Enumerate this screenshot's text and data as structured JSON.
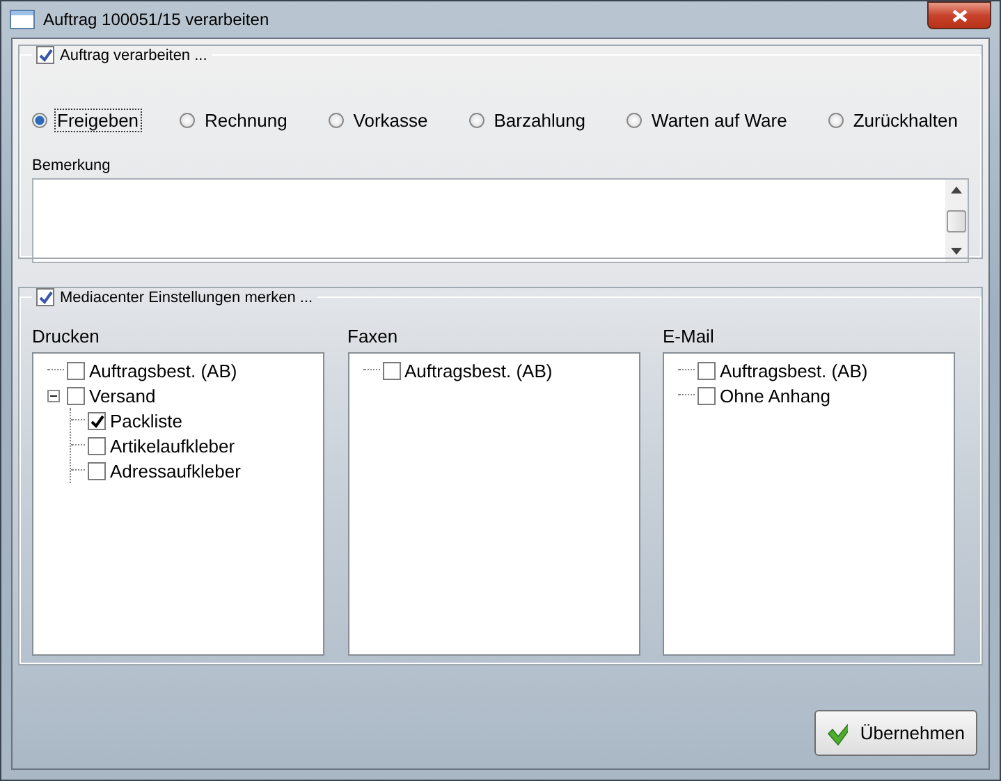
{
  "window": {
    "title": "Auftrag 100051/15 verarbeiten"
  },
  "process_group": {
    "label": "Auftrag verarbeiten ...",
    "checked": true,
    "options": [
      {
        "label": "Freigeben",
        "selected": true
      },
      {
        "label": "Rechnung",
        "selected": false
      },
      {
        "label": "Vorkasse",
        "selected": false
      },
      {
        "label": "Barzahlung",
        "selected": false
      },
      {
        "label": "Warten auf Ware",
        "selected": false
      },
      {
        "label": "Zurückhalten",
        "selected": false
      }
    ],
    "remark": {
      "label": "Bemerkung"
    }
  },
  "media_group": {
    "label": "Mediacenter Einstellungen merken ...",
    "checked": true,
    "columns": [
      {
        "title": "Drucken",
        "items": [
          {
            "label": "Auftragsbest. (AB)",
            "checked": false
          },
          {
            "label": "Versand",
            "checked": false,
            "expanded": true,
            "children": [
              {
                "label": "Packliste",
                "checked": true
              },
              {
                "label": "Artikelaufkleber",
                "checked": false
              },
              {
                "label": "Adressaufkleber",
                "checked": false
              }
            ]
          }
        ]
      },
      {
        "title": "Faxen",
        "items": [
          {
            "label": "Auftragsbest. (AB)",
            "checked": false
          }
        ]
      },
      {
        "title": "E-Mail",
        "items": [
          {
            "label": "Auftragsbest. (AB)",
            "checked": false
          },
          {
            "label": "Ohne Anhang",
            "checked": false
          }
        ]
      }
    ]
  },
  "buttons": [
    {
      "label": "Übernehmen"
    }
  ]
}
